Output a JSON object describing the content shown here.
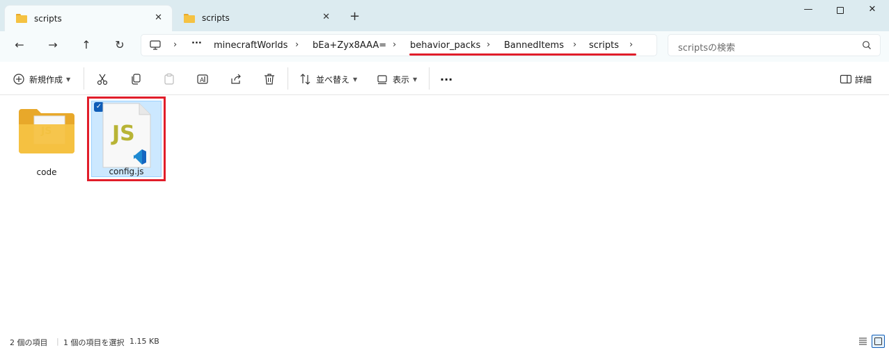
{
  "tabs": [
    {
      "label": "scripts",
      "active": true
    },
    {
      "label": "scripts",
      "active": false
    }
  ],
  "window": {
    "new_tab": "+",
    "minimize": "—",
    "close": "✕"
  },
  "nav": {
    "back": "←",
    "forward": "→",
    "up": "↑",
    "refresh": "↻"
  },
  "address": {
    "overflow": "···",
    "crumbs": [
      "minecraftWorlds",
      "bEa+Zyx8AAA=",
      "behavior_packs",
      "BannedItems",
      "scripts"
    ],
    "chevron": "›"
  },
  "search": {
    "placeholder": "scriptsの検索"
  },
  "toolbar": {
    "new_label": "新規作成",
    "sort_label": "並べ替え",
    "view_label": "表示",
    "more_label": "···",
    "details_label": "詳細"
  },
  "items": [
    {
      "name": "code",
      "type": "folder",
      "selected": false
    },
    {
      "name": "config.js",
      "type": "js-file",
      "selected": true,
      "badge": "JS"
    }
  ],
  "status": {
    "count": "2 個の項目",
    "selection": "1 個の項目を選択",
    "size": "1.15 KB"
  },
  "colors": {
    "accent": "#0f5db8",
    "highlight": "#e11d2a",
    "selection_bg": "#cce8ff",
    "js_text": "#b8b436",
    "vscode_blue": "#1f8ad2",
    "folder": "#f5c242"
  }
}
